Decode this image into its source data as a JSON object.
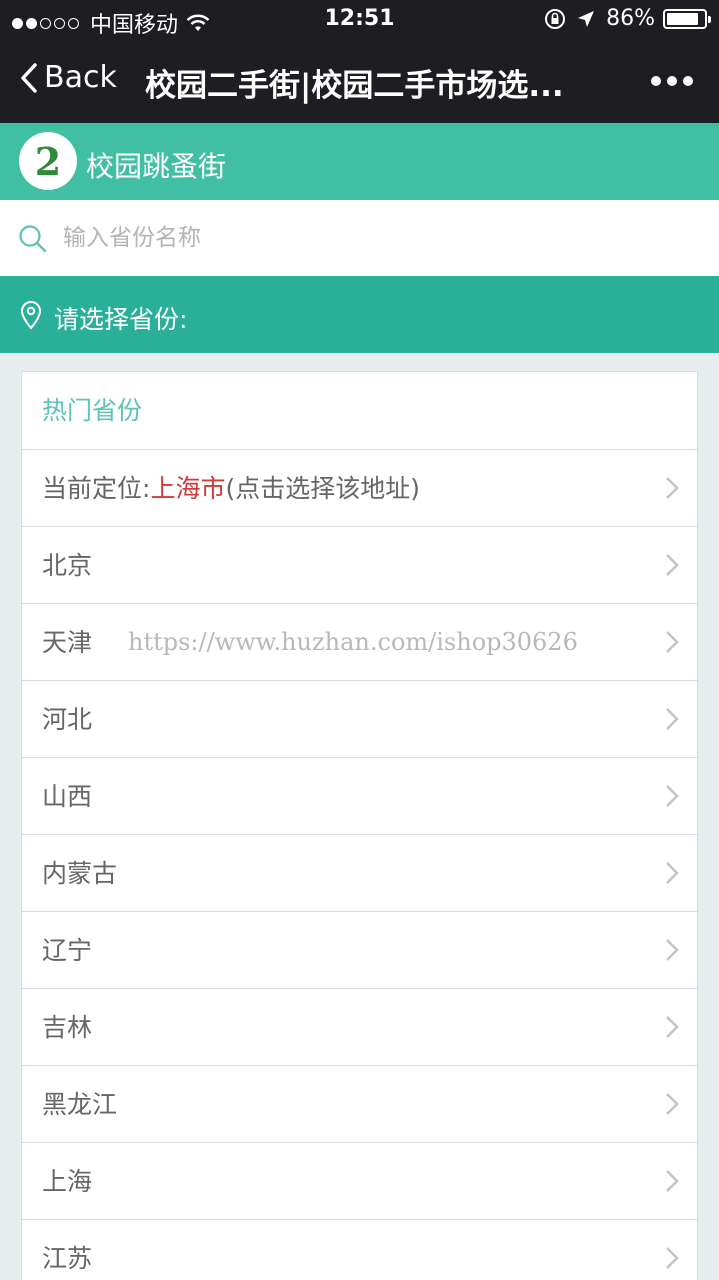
{
  "status_bar": {
    "carrier": "中国移动",
    "time": "12:51",
    "battery": "86%",
    "battery_level": 0.86
  },
  "nav": {
    "back_label": "Back",
    "title": "校园二手街|校园二手市场选..."
  },
  "brand": {
    "logo_text": "2",
    "name": "校园跳蚤街"
  },
  "search": {
    "placeholder": "输入省份名称",
    "value": ""
  },
  "choose": {
    "label": "请选择省份:"
  },
  "list": {
    "header": "热门省份",
    "current_location": {
      "prefix": "当前定位:",
      "city": "上海市",
      "suffix": "(点击选择该地址)"
    },
    "watermark": "https://www.huzhan.com/ishop30626",
    "provinces": [
      "北京",
      "天津",
      "河北",
      "山西",
      "内蒙古",
      "辽宁",
      "吉林",
      "黑龙江",
      "上海",
      "江苏"
    ]
  },
  "colors": {
    "brand_bar": "#40bfa3",
    "choose_bar": "#2aaf98",
    "header_text": "#5cc4b4",
    "location_city": "#d03a3a"
  }
}
